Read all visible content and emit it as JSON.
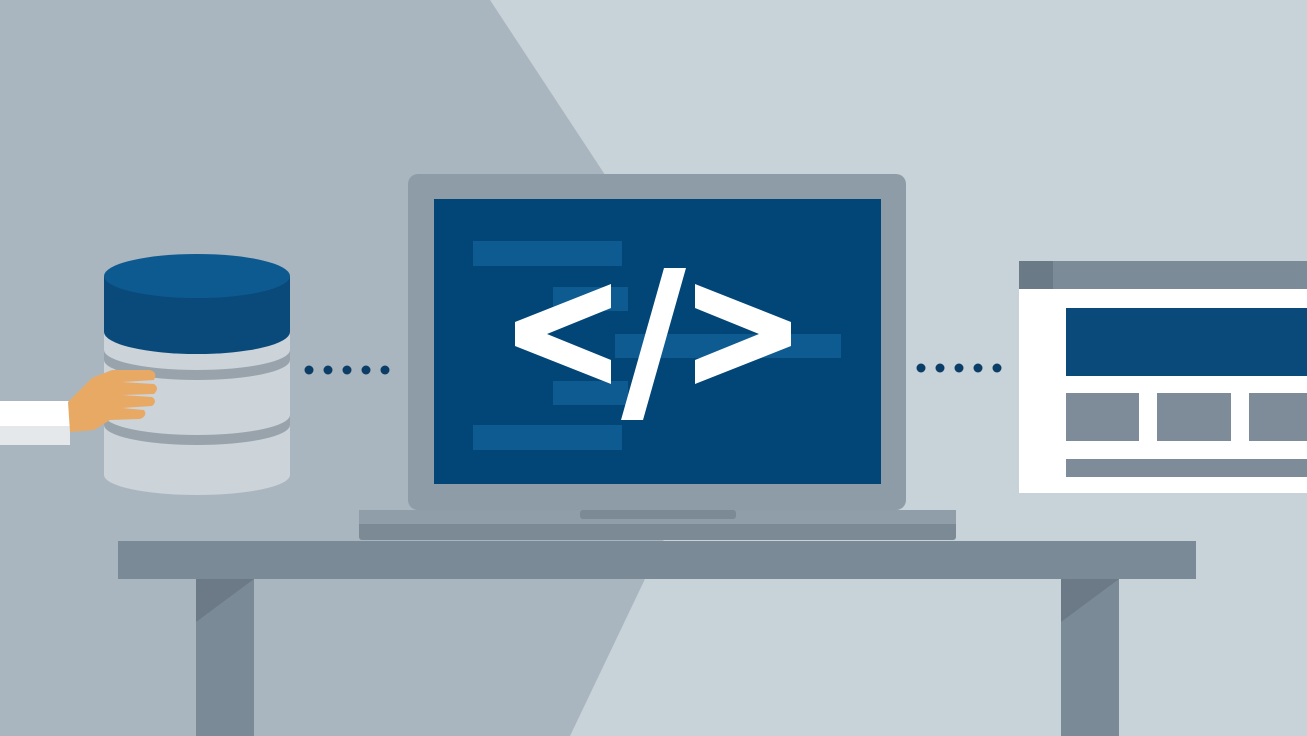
{
  "laptop": {
    "code_symbol": "</>"
  },
  "colors": {
    "background_light": "#c8d2d9",
    "background_dark": "#aab6bf",
    "screen_blue": "#024677",
    "code_line_blue": "#0e5b92",
    "laptop_bezel": "#8e9ca7",
    "laptop_base": "#7c8a96",
    "desk_top": "#7b8a97",
    "desk_leg": "#7b8a97",
    "desk_leg_shade": "#6b7a86",
    "database_top": "#0a4a7a",
    "database_top_face": "#0d5a91",
    "database_body": "#ccd3d9",
    "database_band": "#98a3ac",
    "hand_skin": "#e8a964",
    "sleeve": "#ffffff",
    "dots": "#0c3d66",
    "browser_frame": "#ffffff",
    "browser_bar": "#7b8b97",
    "browser_header": "#0a4a7a",
    "browser_tiles": "#7d8c98"
  },
  "icons": [
    "database-icon",
    "hand-icon",
    "laptop-icon",
    "code-brackets-icon",
    "browser-window-icon",
    "connector-dots-icon",
    "desk-icon"
  ]
}
